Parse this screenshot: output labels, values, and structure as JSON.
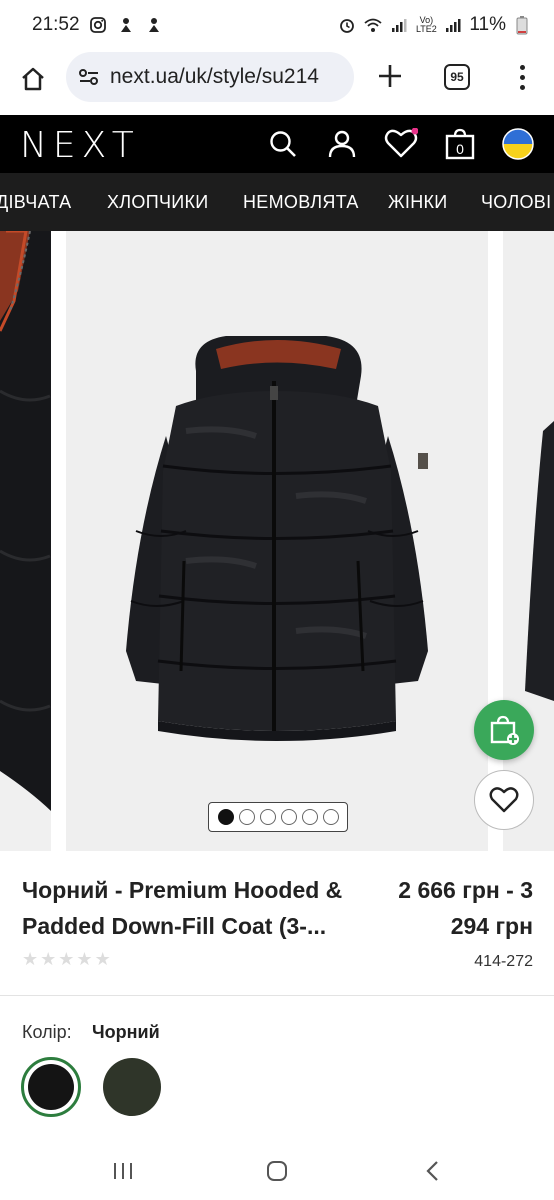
{
  "status_bar": {
    "time": "21:52",
    "battery": "11%"
  },
  "browser": {
    "url": "next.ua/uk/style/su214",
    "tab_count": "95"
  },
  "site": {
    "logo": "NEXT",
    "cart_count": "0"
  },
  "nav": {
    "items": [
      "ДІВЧАТА",
      "ХЛОПЧИКИ",
      "НЕМОВЛЯТА",
      "ЖІНКИ",
      "ЧОЛОВІ"
    ]
  },
  "gallery": {
    "image_count": 6,
    "active_index": 0
  },
  "product": {
    "title": "Чорний - Premium Hooded & Padded Down-Fill Coat (3-...",
    "price": "2 666 грн - 3 294 грн",
    "sku": "414-272",
    "rating_stars": 5,
    "rating_value": 0,
    "color_label": "Колір:",
    "color_value": "Чорний",
    "swatches": [
      {
        "name": "black",
        "color": "#141414",
        "selected": true
      },
      {
        "name": "khaki",
        "color": "#2f3529",
        "selected": false
      }
    ]
  },
  "colors": {
    "accent_green": "#3aa85a",
    "header_bg": "#000000",
    "nav_bg": "#1d1d1d"
  }
}
